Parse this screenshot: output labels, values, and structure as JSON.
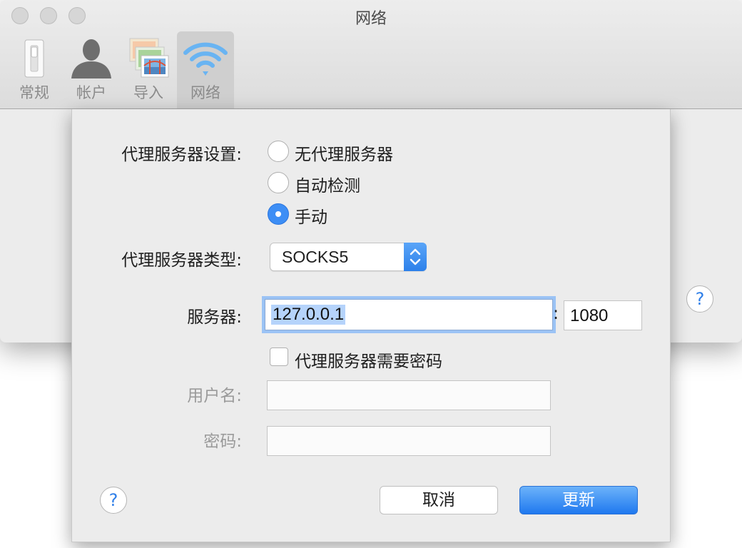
{
  "window": {
    "title": "网络",
    "toolbar": [
      {
        "label": "常规",
        "icon": "toggle-switch-icon"
      },
      {
        "label": "帐户",
        "icon": "user-silhouette-icon"
      },
      {
        "label": "导入",
        "icon": "photos-import-icon"
      },
      {
        "label": "网络",
        "icon": "wifi-icon",
        "selected": true
      }
    ],
    "help_label": "?"
  },
  "sheet": {
    "proxy_setting_label": "代理服务器设置:",
    "proxy_options": [
      {
        "label": "无代理服务器",
        "selected": false
      },
      {
        "label": "自动检测",
        "selected": false
      },
      {
        "label": "手动",
        "selected": true
      }
    ],
    "proxy_type_label": "代理服务器类型:",
    "proxy_type_value": "SOCKS5",
    "server_label": "服务器:",
    "server_value": "127.0.0.1",
    "port_separator": ":",
    "port_value": "1080",
    "requires_password_label": "代理服务器需要密码",
    "requires_password_checked": false,
    "username_label": "用户名:",
    "username_value": "",
    "password_label": "密码:",
    "password_value": "",
    "help_label": "?",
    "cancel_label": "取消",
    "update_label": "更新"
  },
  "colors": {
    "accent": "#3d8ef5",
    "focus_ring": "#9bc3f5",
    "selection": "#b5d3fb",
    "disabled_text": "#9a9a9a"
  }
}
